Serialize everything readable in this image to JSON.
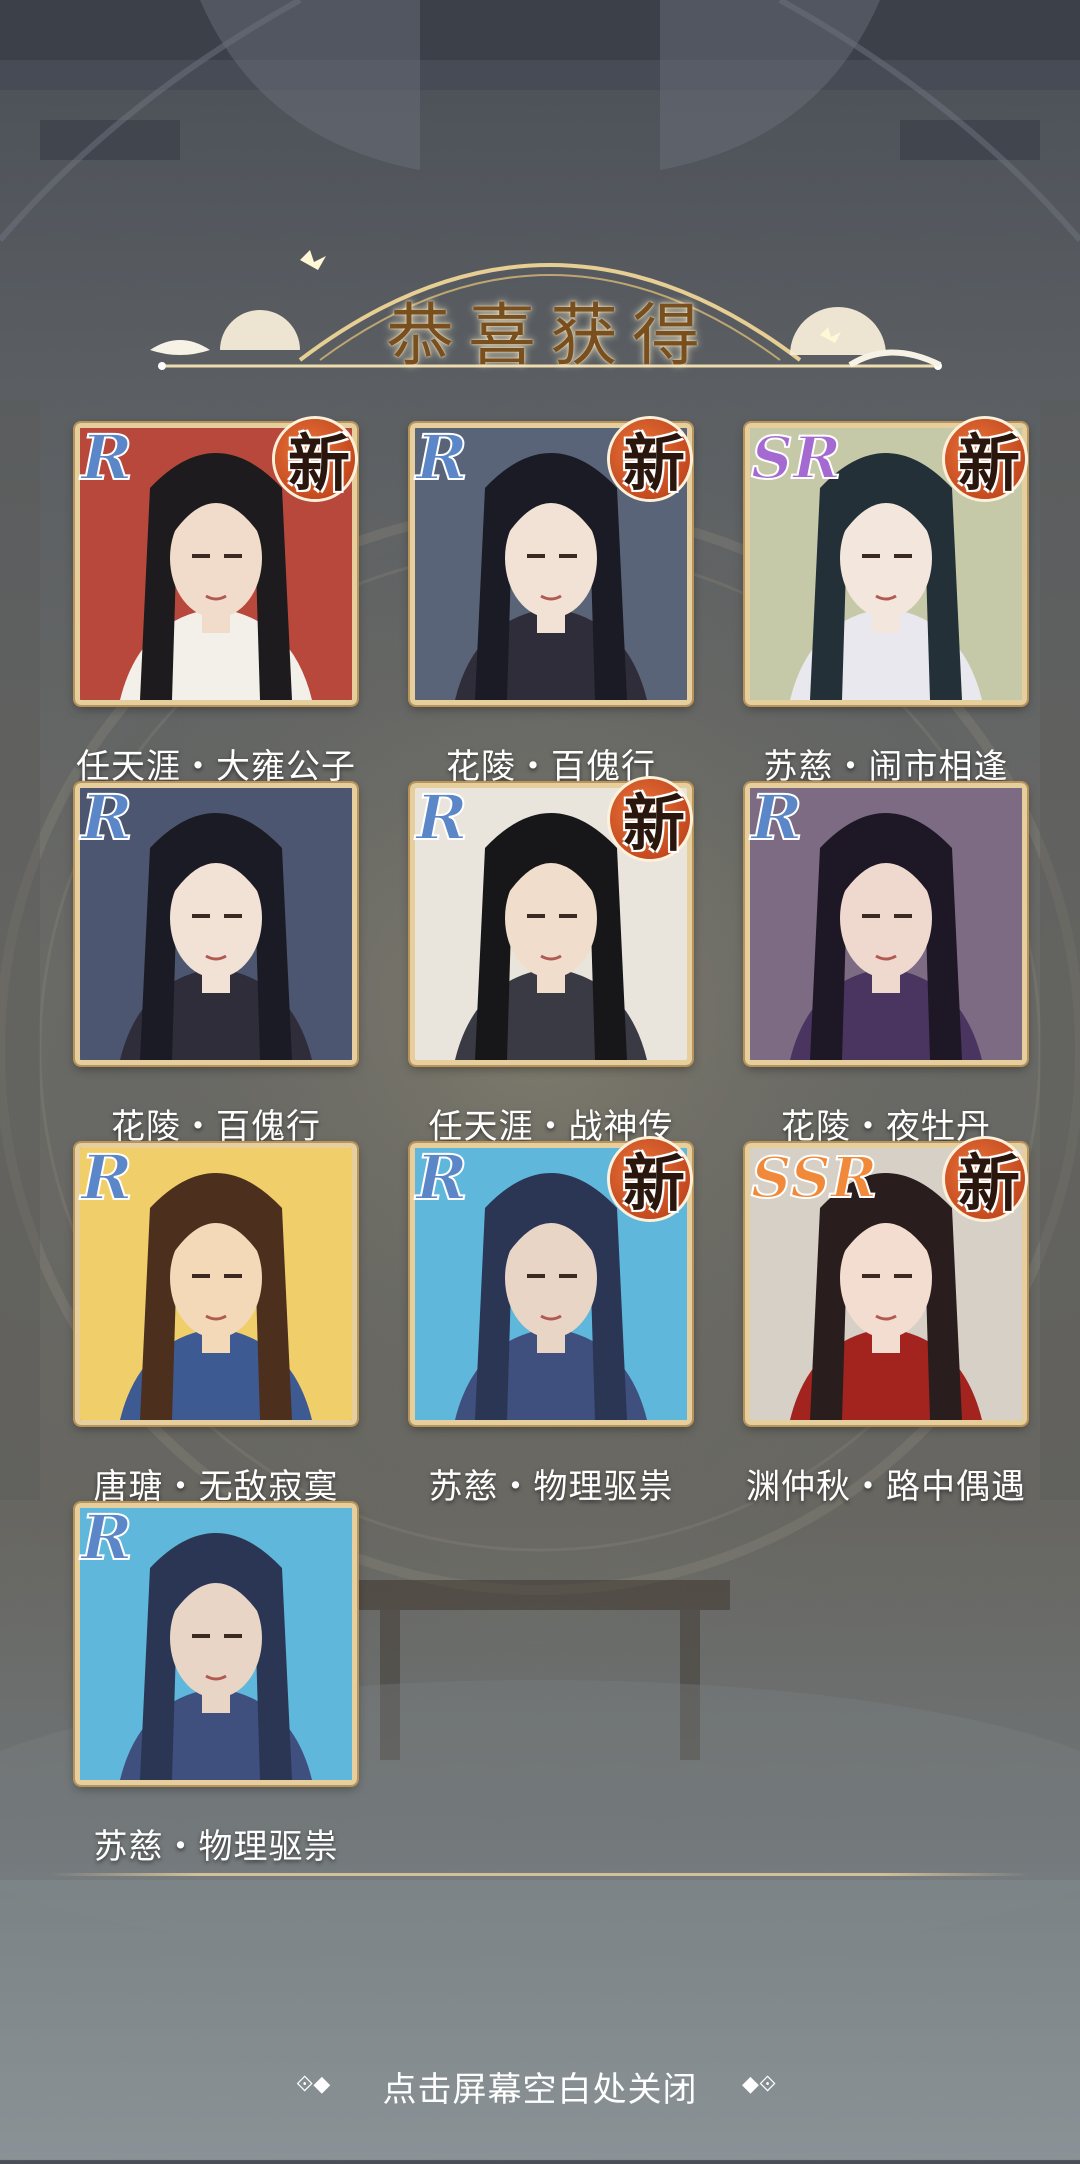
{
  "title": "恭喜获得",
  "new_glyph": "新",
  "close_hint": "点击屏幕空白处关闭",
  "cards": [
    {
      "rarity": "R",
      "name": "任天涯・大雍公子",
      "is_new": true,
      "palette": {
        "bg": "#b8483c",
        "skin": "#f1dccb",
        "hair": "#1d1b1e",
        "cloth": "#f3efe9"
      }
    },
    {
      "rarity": "R",
      "name": "花陵・百傀行",
      "is_new": true,
      "palette": {
        "bg": "#5a6478",
        "skin": "#f2e2d6",
        "hair": "#1a1b24",
        "cloth": "#2f2d3a"
      }
    },
    {
      "rarity": "SR",
      "name": "苏慈・闹市相逢",
      "is_new": true,
      "palette": {
        "bg": "#c6c9a8",
        "skin": "#f3e7dd",
        "hair": "#233038",
        "cloth": "#e8e8ee"
      }
    },
    {
      "rarity": "R",
      "name": "花陵・百傀行",
      "is_new": false,
      "palette": {
        "bg": "#4d5670",
        "skin": "#f2e2d6",
        "hair": "#1a1b24",
        "cloth": "#2f2d3a"
      }
    },
    {
      "rarity": "R",
      "name": "任天涯・战神传",
      "is_new": true,
      "palette": {
        "bg": "#e9e5dc",
        "skin": "#f1ddcc",
        "hair": "#17171a",
        "cloth": "#3a3a44"
      }
    },
    {
      "rarity": "R",
      "name": "花陵・夜牡丹",
      "is_new": false,
      "palette": {
        "bg": "#7d6b84",
        "skin": "#efd9cf",
        "hair": "#1d1726",
        "cloth": "#4a3560"
      }
    },
    {
      "rarity": "R",
      "name": "唐瑭・无敌寂寞",
      "is_new": false,
      "palette": {
        "bg": "#f0cf6a",
        "skin": "#f3d9b8",
        "hair": "#4c2f1d",
        "cloth": "#3d5a93"
      }
    },
    {
      "rarity": "R",
      "name": "苏慈・物理驱祟",
      "is_new": true,
      "palette": {
        "bg": "#5fb8dc",
        "skin": "#e8d5c5",
        "hair": "#2b3554",
        "cloth": "#3f4f7e"
      }
    },
    {
      "rarity": "SSR",
      "name": "渊仲秋・路中偶遇",
      "is_new": true,
      "palette": {
        "bg": "#d7d0c7",
        "skin": "#f3ddd0",
        "hair": "#2a1d1d",
        "cloth": "#a3231e"
      }
    },
    {
      "rarity": "R",
      "name": "苏慈・物理驱祟",
      "is_new": false,
      "palette": {
        "bg": "#5fb8dc",
        "skin": "#e8d5c5",
        "hair": "#2b3554",
        "cloth": "#3f4f7e"
      }
    }
  ]
}
